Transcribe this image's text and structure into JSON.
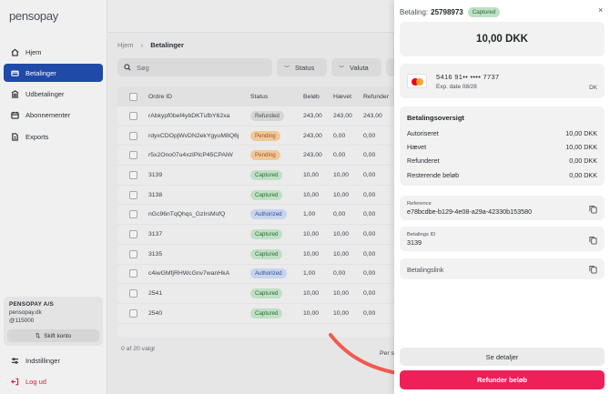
{
  "brand": {
    "logo_text": "pensopay"
  },
  "sidebar": {
    "items": [
      {
        "label": "Hjem",
        "icon": "home-icon",
        "active": false
      },
      {
        "label": "Betalinger",
        "icon": "payments-icon",
        "active": true
      },
      {
        "label": "Udbetalinger",
        "icon": "bank-icon",
        "active": false
      },
      {
        "label": "Abonnementer",
        "icon": "calendar-icon",
        "active": false
      },
      {
        "label": "Exports",
        "icon": "document-icon",
        "active": false
      }
    ],
    "account": {
      "name": "PENSOPAY A/S",
      "domain": "pensopay.dk",
      "handle": "@115000",
      "switch_label": "Skift konto"
    },
    "settings_label": "Indstillinger",
    "logout_label": "Log ud"
  },
  "breadcrumb": {
    "home": "Hjem",
    "current": "Betalinger"
  },
  "filters": {
    "search_placeholder": "Søg",
    "status_label": "Status",
    "currency_label": "Valuta"
  },
  "table": {
    "headers": {
      "order_id": "Ordre ID",
      "status": "Status",
      "amount": "Beløb",
      "captured": "Hævet",
      "refunded": "Refunder"
    },
    "rows": [
      {
        "id": "rAbkypf0bef4ybDKTufbY62xa",
        "status": "Refunded",
        "amount": "243,00",
        "captured": "243,00",
        "refunded": "243,00"
      },
      {
        "id": "rdyxCDOpjWvDN2ekYgyuM8Q6j",
        "status": "Pending",
        "amount": "243,00",
        "captured": "0,00",
        "refunded": "0,00"
      },
      {
        "id": "r5x2Ono07u4xzIPlcP45CPAiW",
        "status": "Pending",
        "amount": "243,00",
        "captured": "0,00",
        "refunded": "0,00"
      },
      {
        "id": "3139",
        "status": "Captured",
        "amount": "10,00",
        "captured": "10,00",
        "refunded": "0,00"
      },
      {
        "id": "3138",
        "status": "Captured",
        "amount": "10,00",
        "captured": "10,00",
        "refunded": "0,00"
      },
      {
        "id": "nGc96nTqQhqs_GzIrsMsfQ",
        "status": "Authorized",
        "amount": "1,00",
        "captured": "0,00",
        "refunded": "0,00"
      },
      {
        "id": "3137",
        "status": "Captured",
        "amount": "10,00",
        "captured": "10,00",
        "refunded": "0,00"
      },
      {
        "id": "3135",
        "status": "Captured",
        "amount": "10,00",
        "captured": "10,00",
        "refunded": "0,00"
      },
      {
        "id": "c4iwGMfjRHWcGnv7wanHkA",
        "status": "Authorized",
        "amount": "1,00",
        "captured": "0,00",
        "refunded": "0,00"
      },
      {
        "id": "2541",
        "status": "Captured",
        "amount": "10,00",
        "captured": "10,00",
        "refunded": "0,00"
      },
      {
        "id": "2540",
        "status": "Captured",
        "amount": "10,00",
        "captured": "10,00",
        "refunded": "0,00"
      }
    ],
    "selection_text": "0 af 20 valgt",
    "per_page_text": "Per s"
  },
  "panel": {
    "payment_label": "Betaling:",
    "order_id": "25798973",
    "status_badge": "Captured",
    "close_symbol": "×",
    "amount": "10,00 DKK",
    "card": {
      "number": "5416 91•• •••• 7737",
      "expiry": "Exp. date 08/28",
      "country": "DK",
      "brand_icon": "mastercard-icon"
    },
    "overview": {
      "title": "Betalingsoversigt",
      "rows": [
        {
          "label": "Autoriseret",
          "value": "10,00 DKK"
        },
        {
          "label": "Hævet",
          "value": "10,00 DKK"
        },
        {
          "label": "Refunderet",
          "value": "0,00 DKK"
        },
        {
          "label": "Resterende beløb",
          "value": "0,00 DKK"
        }
      ]
    },
    "reference": {
      "label": "Reference",
      "value": "e78bcdbe-b129-4e08-a29a-42330b153580"
    },
    "payment_id": {
      "label": "Betalings ID",
      "value": "3139"
    },
    "payment_link": {
      "label": "Betalingslink"
    },
    "details_button": "Se detaljer",
    "refund_button": "Refunder beløb"
  },
  "colors": {
    "accent": "#1f4aa8",
    "refund": "#ef1f5a",
    "arrow": "#f05a4f"
  }
}
